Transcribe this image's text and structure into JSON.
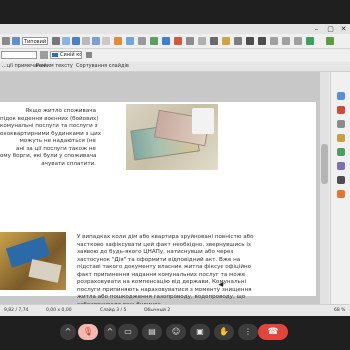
{
  "toolbar": {
    "style_value": "Типовий",
    "color_name": "Синій кол"
  },
  "tabs": [
    "...ції примечаний",
    "Режим тексту",
    "Сортування слайдів"
  ],
  "slide": {
    "left_column": [
      "Якщо житло споживача",
      "підок ведення воєнних (бойових)",
      "комунальні послуги та послуги з",
      "охоквартирними будинками з цих",
      "можуть не надаються (не",
      "ані за ції послуги також не",
      "ому борги, які були у споживача",
      "ачувати сплатити."
    ],
    "right_column": [
      "У випадках коли дім або квартира зруйновані повністю або",
      "частково зафіксувати цей факт необхідно, звернувшись із",
      "заявою до будь-якого ЦНАПу, натиснувши або через",
      "застосунок \"Дія\" та оформити відповідний акт. Вже на",
      "підставі такого документу власник житла фіксує офіційно",
      "факт припинення надання комунальних послуг та може",
      "розраховувати на компенсацію від держави. Комунальні",
      "послуги припиняють нараховуватися з моменту знищення",
      "житла або пошкодження газопроводу, водопроводу, що",
      "забезпечували ваш будинок."
    ]
  },
  "status": {
    "position": "9,82 / 7,74",
    "size": "0,00 x 0,00",
    "slide": "Слайд 3 / 5",
    "layout": "Обычный 2",
    "zoom": "68 %"
  },
  "meeting": {
    "more_icon": "^",
    "leave_icon": "☎"
  },
  "colors": {
    "leave": "#e4453a",
    "mic_muted": "#f3b8b0",
    "accent": "#2a6cd4"
  }
}
